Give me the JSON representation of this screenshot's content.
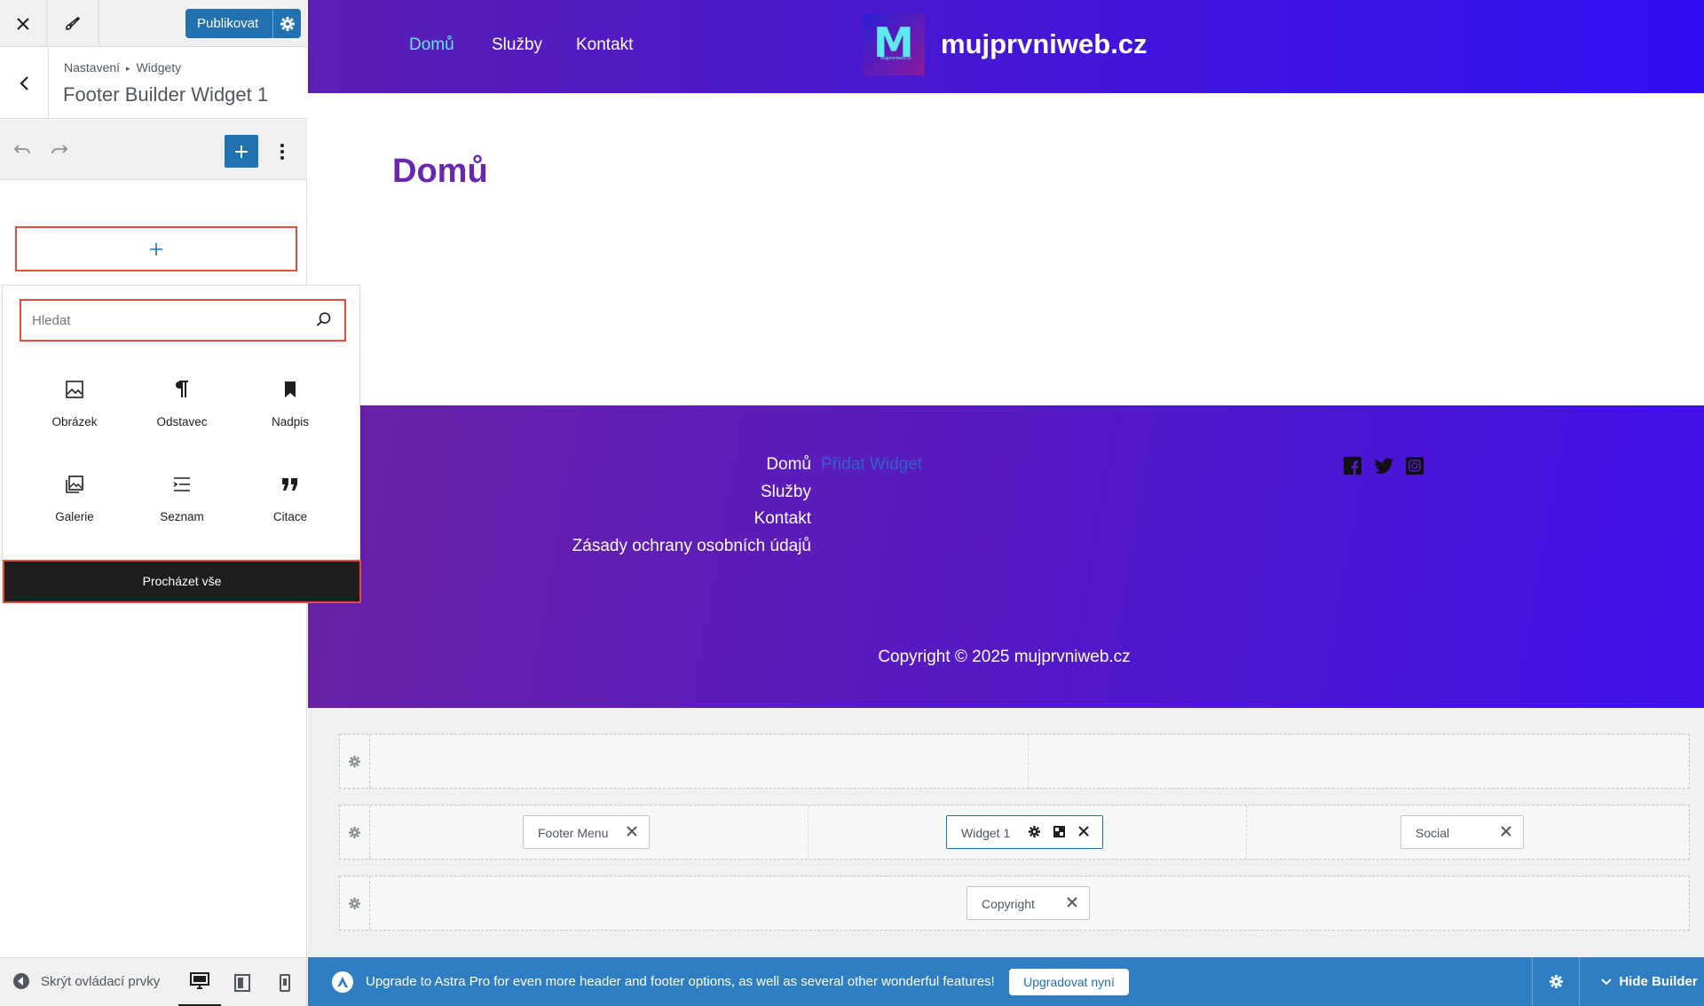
{
  "panel": {
    "publish_label": "Publikovat",
    "breadcrumb": [
      "Nastavení",
      "Widgety"
    ],
    "title": "Footer Builder Widget 1",
    "search_placeholder": "Hledat",
    "blocks": [
      {
        "label": "Obrázek",
        "icon": "image-icon"
      },
      {
        "label": "Odstavec",
        "icon": "paragraph-icon"
      },
      {
        "label": "Nadpis",
        "icon": "heading-icon"
      },
      {
        "label": "Galerie",
        "icon": "gallery-icon"
      },
      {
        "label": "Seznam",
        "icon": "list-icon"
      },
      {
        "label": "Citace",
        "icon": "quote-icon"
      }
    ],
    "browse_all": "Procházet vše",
    "hide_controls": "Skrýt ovládací prvky"
  },
  "site": {
    "nav": [
      "Domů",
      "Služby",
      "Kontakt"
    ],
    "logo_letter": "M",
    "logo_small": "mujprvniweb.cz",
    "name": "mujprvniweb.cz",
    "page_title": "Domů",
    "footer_menu": [
      "Domů",
      "Služby",
      "Kontakt",
      "Zásady ochrany osobních údajů"
    ],
    "add_widget": "Přidat Widget",
    "social": [
      "facebook-icon",
      "twitter-icon",
      "instagram-icon"
    ],
    "copyright": "Copyright © 2025 mujprvniweb.cz"
  },
  "builder": {
    "footer_menu_chip": "Footer Menu",
    "widget_chip": "Widget 1",
    "social_chip": "Social",
    "copyright_chip": "Copyright"
  },
  "astra": {
    "message": "Upgrade to Astra Pro for even more header and footer options, as well as several other wonderful features!",
    "upgrade_label": "Upgradovat nyní",
    "hide_builder": "Hide Builder"
  },
  "colors": {
    "accent": "#2271b1",
    "highlight_border": "#e74c3c",
    "header_gradient_start": "#5b1fb3",
    "header_gradient_end": "#2f0ef0",
    "active_nav": "#5ee9ef",
    "page_title": "#6a25b1"
  }
}
